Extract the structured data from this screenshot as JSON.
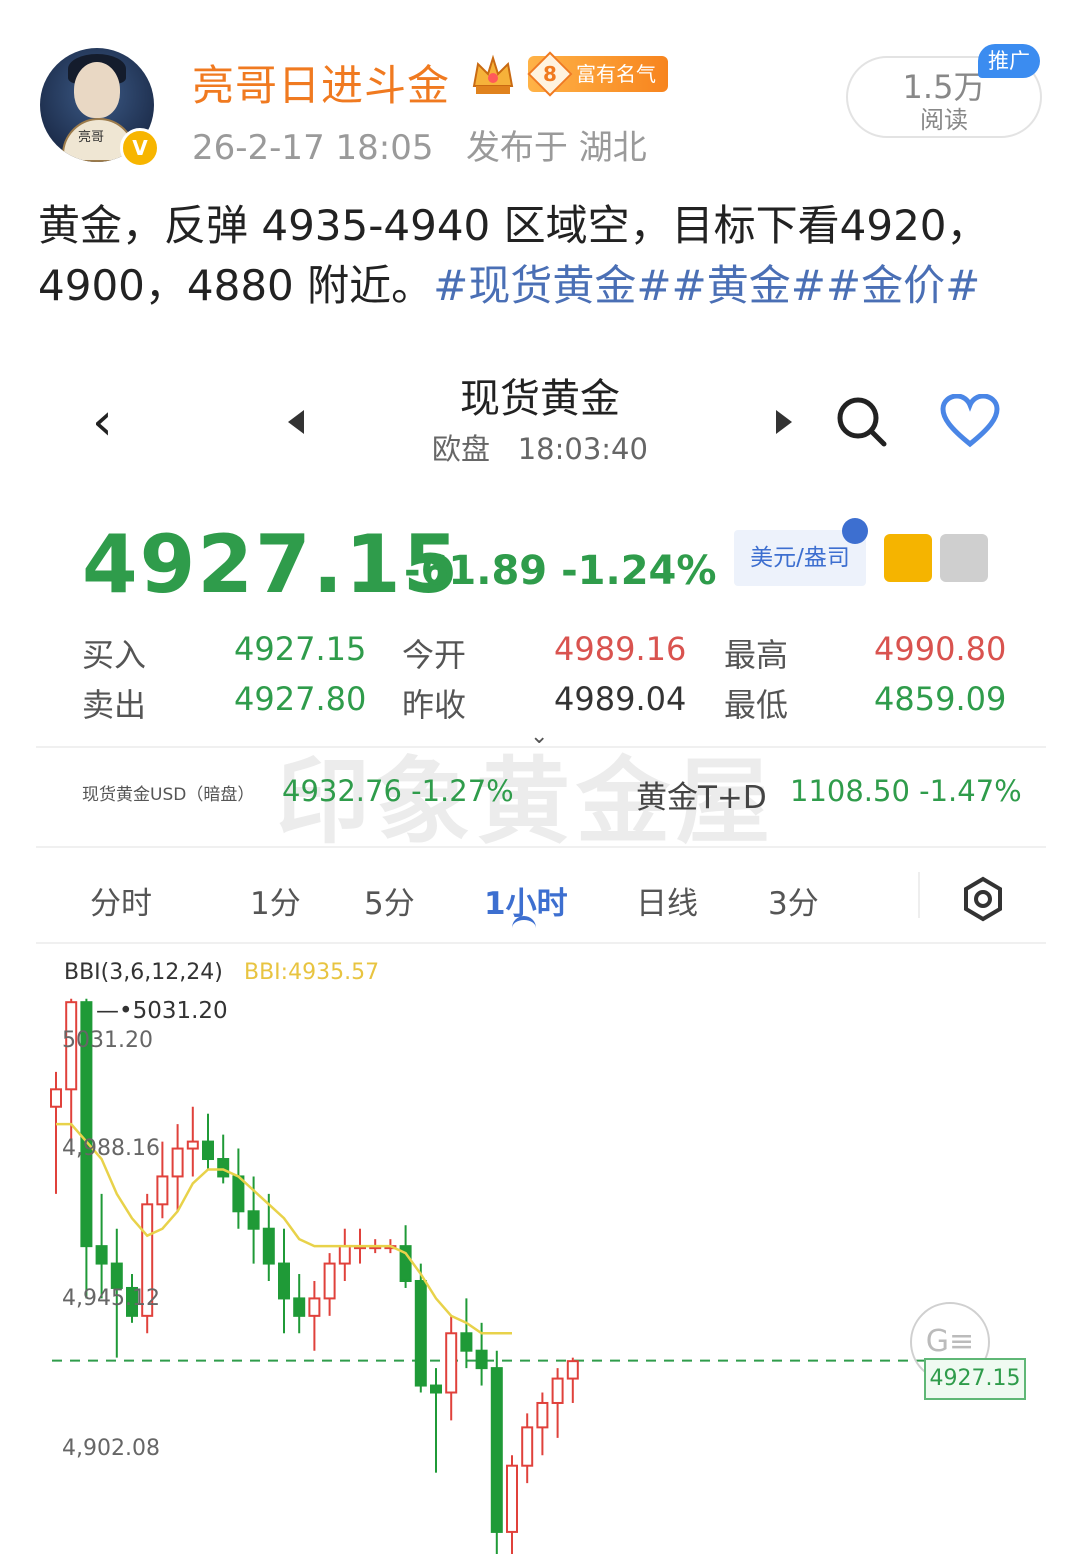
{
  "post": {
    "username": "亮哥日进斗金",
    "avatar_text": "亮哥",
    "verified_icon": "v-badge-icon",
    "fortune_level": "8",
    "fortune_label": "富有名气",
    "timestamp": "26-2-17 18:05",
    "location": "发布于 湖北",
    "read_count": "1.5万",
    "read_label": "阅读",
    "promo_label": "推广",
    "text_main": "黄金，反弹 4935-4940 区域空，目标下看4920，4900，4880 附近。",
    "hashtags": "#现货黄金##黄金##金价#"
  },
  "quote": {
    "title": "现货黄金",
    "session": "欧盘",
    "time": "18:03:40",
    "price": "4927.15",
    "change": "-61.89",
    "change_pct": "-1.24%",
    "unit_label": "美元/盎司",
    "stats": {
      "buy_label": "买入",
      "buy": "4927.15",
      "sell_label": "卖出",
      "sell": "4927.80",
      "open_label": "今开",
      "open": "4989.16",
      "prev_close_label": "昨收",
      "prev_close": "4989.04",
      "high_label": "最高",
      "high": "4990.80",
      "low_label": "最低",
      "low": "4859.09"
    },
    "ref1_label": "现货黄金USD（暗盘）",
    "ref1_value": "4932.76 -1.27%",
    "ref2_label": "黄金T+D",
    "ref2_value": "1108.50 -1.47%",
    "watermark": "印象黄金屋",
    "tabs": [
      "分时",
      "1分",
      "5分",
      "1小时",
      "日线",
      "3分"
    ],
    "active_tab": "1小时"
  },
  "chart_data": {
    "type": "candlestick",
    "indicator_label": "BBI(3,6,12,24)",
    "indicator_value": "BBI:4935.57",
    "high_marker": "5031.20",
    "y_tick_labels": [
      "5031.20",
      "4,988.16",
      "4,945.12",
      "4,902.08"
    ],
    "current_price_tag": "4927.15",
    "colors": {
      "up": "#e0413b",
      "down": "#1f9a37",
      "bbi": "#e8d24a"
    },
    "candles": [
      {
        "o": 5000,
        "h": 5010,
        "l": 4975,
        "c": 5005
      },
      {
        "o": 5005,
        "h": 5031,
        "l": 4990,
        "c": 5030
      },
      {
        "o": 5030,
        "h": 5031,
        "l": 4945,
        "c": 4960
      },
      {
        "o": 4960,
        "h": 4975,
        "l": 4945,
        "c": 4955
      },
      {
        "o": 4955,
        "h": 4965,
        "l": 4928,
        "c": 4948
      },
      {
        "o": 4948,
        "h": 4952,
        "l": 4938,
        "c": 4940
      },
      {
        "o": 4940,
        "h": 4975,
        "l": 4935,
        "c": 4972
      },
      {
        "o": 4972,
        "h": 4990,
        "l": 4968,
        "c": 4980
      },
      {
        "o": 4980,
        "h": 4995,
        "l": 4970,
        "c": 4988
      },
      {
        "o": 4988,
        "h": 5000,
        "l": 4980,
        "c": 4990
      },
      {
        "o": 4990,
        "h": 4998,
        "l": 4982,
        "c": 4985
      },
      {
        "o": 4985,
        "h": 4992,
        "l": 4978,
        "c": 4980
      },
      {
        "o": 4980,
        "h": 4988,
        "l": 4965,
        "c": 4970
      },
      {
        "o": 4970,
        "h": 4980,
        "l": 4955,
        "c": 4965
      },
      {
        "o": 4965,
        "h": 4975,
        "l": 4950,
        "c": 4955
      },
      {
        "o": 4955,
        "h": 4965,
        "l": 4935,
        "c": 4945
      },
      {
        "o": 4945,
        "h": 4952,
        "l": 4935,
        "c": 4940
      },
      {
        "o": 4940,
        "h": 4950,
        "l": 4930,
        "c": 4945
      },
      {
        "o": 4945,
        "h": 4958,
        "l": 4940,
        "c": 4955
      },
      {
        "o": 4955,
        "h": 4965,
        "l": 4950,
        "c": 4960
      },
      {
        "o": 4960,
        "h": 4965,
        "l": 4955,
        "c": 4960
      },
      {
        "o": 4960,
        "h": 4962,
        "l": 4958,
        "c": 4960
      },
      {
        "o": 4960,
        "h": 4962,
        "l": 4958,
        "c": 4960
      },
      {
        "o": 4960,
        "h": 4966,
        "l": 4948,
        "c": 4950
      },
      {
        "o": 4950,
        "h": 4955,
        "l": 4918,
        "c": 4920
      },
      {
        "o": 4920,
        "h": 4925,
        "l": 4895,
        "c": 4918
      },
      {
        "o": 4918,
        "h": 4940,
        "l": 4910,
        "c": 4935
      },
      {
        "o": 4935,
        "h": 4945,
        "l": 4925,
        "c": 4930
      },
      {
        "o": 4930,
        "h": 4938,
        "l": 4920,
        "c": 4925
      },
      {
        "o": 4925,
        "h": 4930,
        "l": 4870,
        "c": 4878
      },
      {
        "o": 4878,
        "h": 4900,
        "l": 4870,
        "c": 4897
      },
      {
        "o": 4897,
        "h": 4912,
        "l": 4892,
        "c": 4908
      },
      {
        "o": 4908,
        "h": 4918,
        "l": 4900,
        "c": 4915
      },
      {
        "o": 4915,
        "h": 4925,
        "l": 4905,
        "c": 4922
      },
      {
        "o": 4922,
        "h": 4928,
        "l": 4915,
        "c": 4927
      }
    ],
    "bbi": [
      4995,
      4995,
      4990,
      4985,
      4975,
      4968,
      4963,
      4965,
      4970,
      4978,
      4982,
      4982,
      4980,
      4976,
      4972,
      4968,
      4962,
      4960,
      4960,
      4960,
      4960,
      4960,
      4960,
      4958,
      4952,
      4945,
      4940,
      4938,
      4935,
      4935,
      4935
    ]
  }
}
